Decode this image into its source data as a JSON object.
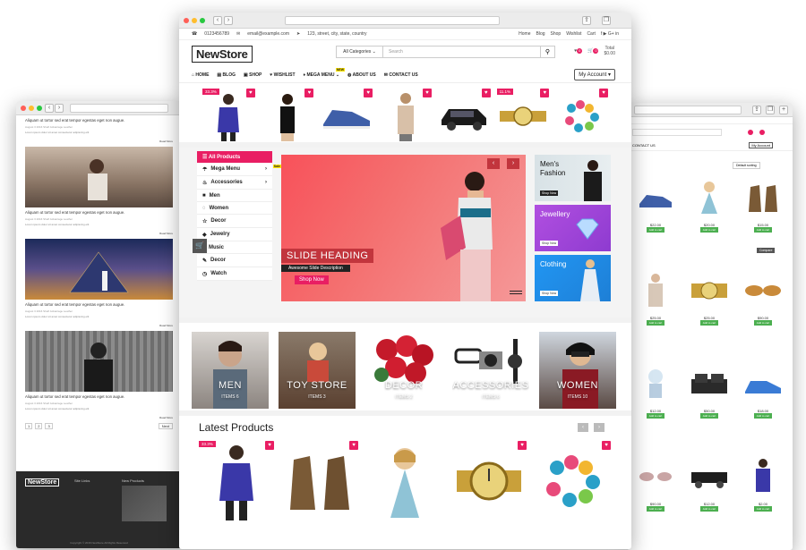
{
  "main": {
    "url": "",
    "topbar": {
      "phone": "0123456789",
      "email": "email@example.com",
      "address": "123, street, city, state, country",
      "links": [
        "Home",
        "Blog",
        "Shop",
        "Wishlist",
        "Cart"
      ],
      "social": "f ▶ G+ in"
    },
    "logo": "NewStore",
    "search": {
      "category": "All Categories",
      "placeholder": "Search"
    },
    "cart": {
      "wish_count": "0",
      "cart_count": "0",
      "total_label": "Total",
      "total": "$0.00"
    },
    "menu": [
      "HOME",
      "BLOG",
      "SHOP",
      "WISHLIST",
      "MEGA MENU",
      "ABOUT US",
      "CONTACT US"
    ],
    "menu_new_tag": "NEW",
    "account": "My Account",
    "top_products_badges": [
      "33.3%",
      "11.1%"
    ],
    "sidebar": {
      "title": "All Products",
      "items": [
        "Mega Menu",
        "Accessories",
        "Men",
        "Women",
        "Decor",
        "Jewelry",
        "Music",
        "Decor",
        "Watch"
      ],
      "sale_tag": "Sale"
    },
    "hero": {
      "heading": "SLIDE HEADING",
      "desc": "Awesome Slide Description",
      "button": "Shop Now"
    },
    "banners": [
      {
        "title": "Men's Fashion",
        "button": "Shop Now",
        "color": "#2a6f86"
      },
      {
        "title": "Jewellery",
        "button": "Shop Now",
        "color": "#a84de0"
      },
      {
        "title": "Clothing",
        "button": "Shop Now",
        "color": "#1e88e5"
      }
    ],
    "categories": [
      {
        "name": "MEN",
        "count": "ITEMS 6"
      },
      {
        "name": "TOY STORE",
        "count": "ITEMS 3"
      },
      {
        "name": "DECOR",
        "count": "ITEMS 2"
      },
      {
        "name": "ACCESSORIES",
        "count": "ITEMS 6"
      },
      {
        "name": "WOMEN",
        "count": "ITEMS 10"
      }
    ],
    "latest": {
      "title": "Latest Products",
      "badge": "33.3%"
    }
  },
  "left": {
    "post_title": "Aliquam ut tortor sed erat tempor egestas eget non augue.",
    "post_meta": "August 3 2016   Shelf Advantage   Leather",
    "read_more": "Read More",
    "pagination": [
      "1",
      "2",
      "3",
      "Next"
    ],
    "footer": {
      "logo": "NewStore",
      "col1": "Site Links",
      "col2": "New Products",
      "copyright": "Copyright © 2016 NewStore All Rights Reserved"
    }
  },
  "right": {
    "sort": "Default sorting",
    "prices": [
      "$22.00",
      "$20.00",
      "$15.00",
      "$25.00",
      "$25.00",
      "$90.00",
      "$12.00",
      "$50.00",
      "$18.00",
      "$90.00",
      "$12.00",
      "$2.00"
    ],
    "add_to_cart": "Add to cart",
    "compare": "Compare"
  },
  "colors": {
    "accent": "#e91e63",
    "dark": "#2a2a2a"
  }
}
